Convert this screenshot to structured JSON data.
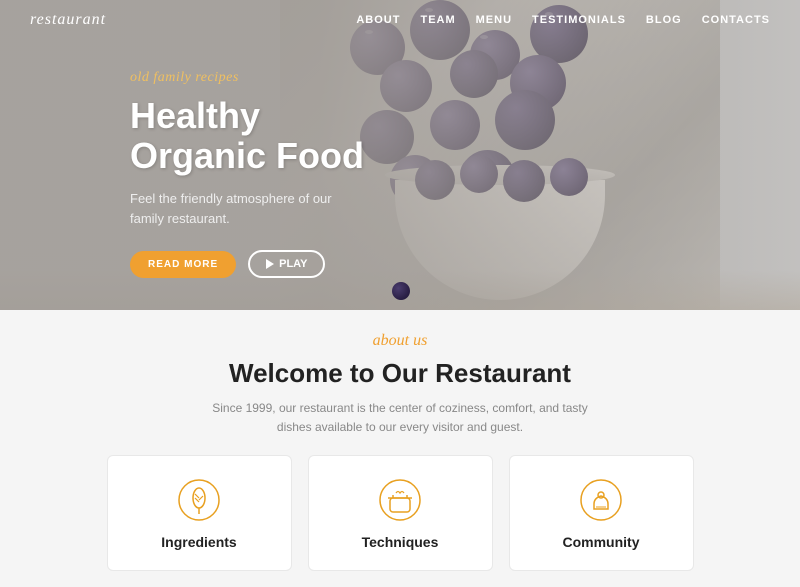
{
  "header": {
    "logo": "restaurant",
    "nav": [
      {
        "label": "ABOUT",
        "id": "about"
      },
      {
        "label": "TEAM",
        "id": "team"
      },
      {
        "label": "MENU",
        "id": "menu"
      },
      {
        "label": "TESTIMONIALS",
        "id": "testimonials"
      },
      {
        "label": "BLOG",
        "id": "blog"
      },
      {
        "label": "CONTACTS",
        "id": "contacts"
      }
    ]
  },
  "hero": {
    "subtitle": "old family recipes",
    "title_line1": "Healthy",
    "title_line2": "Organic Food",
    "description": "Feel the friendly atmosphere of our family restaurant.",
    "btn_read_more": "READ MORE",
    "btn_play": "PLAY"
  },
  "about": {
    "label": "about us",
    "title": "Welcome to Our Restaurant",
    "description": "Since 1999, our restaurant is the center of coziness, comfort, and tasty dishes available to our every visitor and guest."
  },
  "cards": [
    {
      "id": "ingredients",
      "title": "Ingredients",
      "icon": "leaf"
    },
    {
      "id": "techniques",
      "title": "Techniques",
      "icon": "pot"
    },
    {
      "id": "community",
      "title": "Community",
      "icon": "chef"
    }
  ],
  "colors": {
    "accent": "#f0a030",
    "dark": "#222222",
    "light_text": "#888888",
    "white": "#ffffff",
    "card_border": "#e8e8e8"
  }
}
